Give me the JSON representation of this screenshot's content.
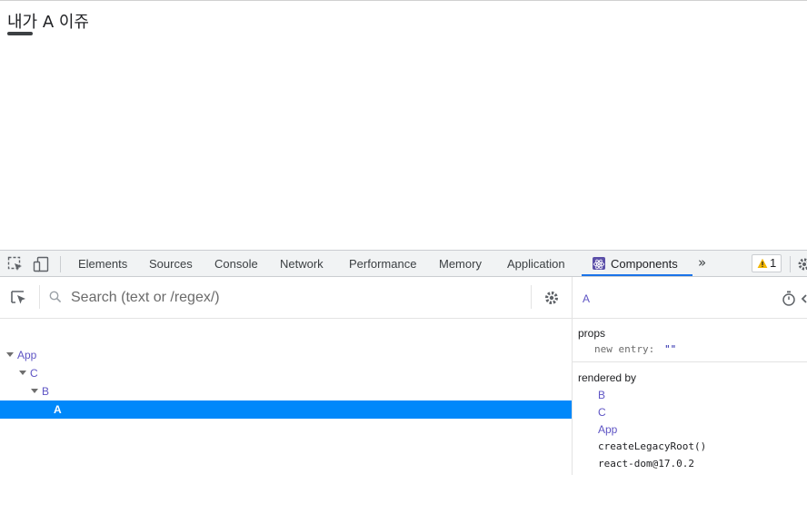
{
  "page": {
    "text": "내가 A 이쥬"
  },
  "devtools": {
    "tabs": [
      "Elements",
      "Sources",
      "Console",
      "Network",
      "Performance",
      "Memory",
      "Application",
      "Components"
    ],
    "active_tab": "Components",
    "more_tabs_glyph": "»",
    "warning_count": "1",
    "icons": [
      "inspect-element-icon",
      "device-toolbar-icon",
      "react-logo-icon",
      "warning-icon",
      "settings-icon"
    ]
  },
  "components": {
    "search_placeholder": "Search (text or /regex/)",
    "tree": [
      {
        "name": "App",
        "depth": 0,
        "expanded": true
      },
      {
        "name": "C",
        "depth": 1,
        "expanded": true
      },
      {
        "name": "B",
        "depth": 2,
        "expanded": true
      },
      {
        "name": "A",
        "depth": 3,
        "selected": true
      }
    ],
    "selected_component": "A",
    "props_label": "props",
    "props": [
      {
        "key": "new entry:",
        "value": "\"\""
      }
    ],
    "rendered_by_label": "rendered by",
    "rendered_by": [
      "B",
      "C",
      "App",
      "createLegacyRoot()",
      "react-dom@17.0.2"
    ]
  },
  "colors": {
    "selected_row": "#0088fa",
    "component_name": "#5e54c4",
    "active_tab_underline": "#1a73e8",
    "warning": "#f2b600"
  }
}
